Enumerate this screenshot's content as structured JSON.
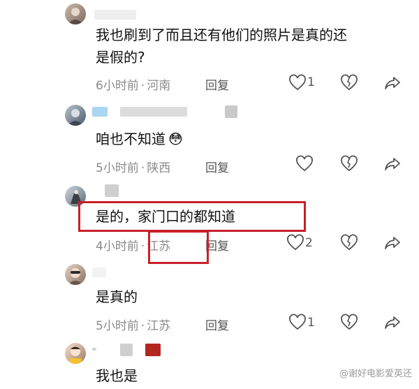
{
  "comments": [
    {
      "text_line1": "我也刷到了而且还有他们的照片是真的还",
      "text_line2": "是假的?",
      "time": "6小时前",
      "location": "河南",
      "reply_label": "回复",
      "like_count": "1"
    },
    {
      "text_line1": "咱也不知道",
      "emoji": "😳",
      "time": "5小时前",
      "location": "陕西",
      "reply_label": "回复",
      "like_count": ""
    },
    {
      "text_line1": "是的，家门口的都知道",
      "time": "4小时前",
      "location": "江苏",
      "reply_label": "回复",
      "like_count": "2"
    },
    {
      "text_line1": "是真的",
      "time": "5小时前",
      "location": "江苏",
      "reply_label": "回复",
      "like_count": "1"
    },
    {
      "text_line1": "我也是"
    }
  ],
  "meta_separator": "·",
  "watermark": "@谢好电影爱英还",
  "colors": {
    "highlight": "#c8202a",
    "meta_text": "#8a8a8a",
    "body_text": "#111111"
  }
}
